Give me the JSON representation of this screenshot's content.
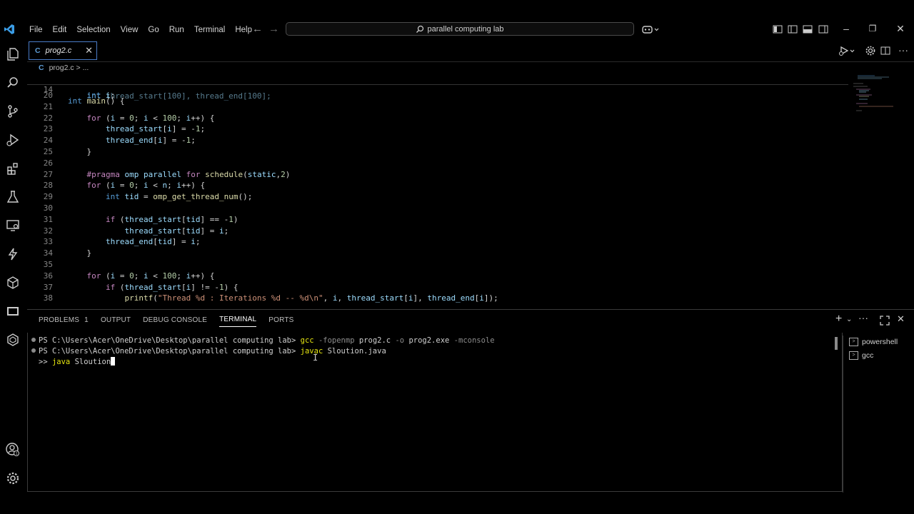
{
  "menu": [
    "File",
    "Edit",
    "Selection",
    "View",
    "Go",
    "Run",
    "Terminal",
    "Help"
  ],
  "search": {
    "text": "parallel computing lab"
  },
  "editor": {
    "tab_letter": "C",
    "tab_title": "prog2.c",
    "breadcrumb_file": "prog2.c",
    "breadcrumb_rest": "> ...",
    "sticky": {
      "num": "14",
      "text": "int main() {"
    },
    "lines": [
      {
        "num": "20",
        "text": "    int i;"
      },
      {
        "num": "21",
        "text": ""
      },
      {
        "num": "22",
        "text": "    for (i = 0; i < 100; i++) {"
      },
      {
        "num": "23",
        "text": "        thread_start[i] = -1;"
      },
      {
        "num": "24",
        "text": "        thread_end[i] = -1;"
      },
      {
        "num": "25",
        "text": "    }"
      },
      {
        "num": "26",
        "text": ""
      },
      {
        "num": "27",
        "text": "    #pragma omp parallel for schedule(static,2)"
      },
      {
        "num": "28",
        "text": "    for (i = 0; i < n; i++) {"
      },
      {
        "num": "29",
        "text": "        int tid = omp_get_thread_num();"
      },
      {
        "num": "30",
        "text": ""
      },
      {
        "num": "31",
        "text": "        if (thread_start[tid] == -1)"
      },
      {
        "num": "32",
        "text": "            thread_start[tid] = i;"
      },
      {
        "num": "33",
        "text": "        thread_end[tid] = i;"
      },
      {
        "num": "34",
        "text": "    }"
      },
      {
        "num": "35",
        "text": ""
      },
      {
        "num": "36",
        "text": "    for (i = 0; i < 100; i++) {"
      },
      {
        "num": "37",
        "text": "        if (thread_start[i] != -1) {"
      },
      {
        "num": "38",
        "text": "            printf(\"Thread %d : Iterations %d -- %d\\n\", i, thread_start[i], thread_end[i]);"
      }
    ]
  },
  "panel": {
    "tabs": [
      "PROBLEMS",
      "OUTPUT",
      "DEBUG CONSOLE",
      "TERMINAL",
      "PORTS"
    ],
    "problems_count": "1",
    "active_tab": "TERMINAL"
  },
  "terminal": {
    "prompt": "PS C:\\Users\\Acer\\OneDrive\\Desktop\\parallel computing lab> ",
    "line1": {
      "cmd": "gcc",
      "a1": "-fopenmp",
      "a2": "prog2.c",
      "a3": "-o",
      "a4": "prog2.exe",
      "a5": "-mconsole"
    },
    "line2": {
      "cmd": "javac",
      "arg": "Sloution.java"
    },
    "line3": {
      "prefix": ">> ",
      "cmd": "java",
      "arg": "Sloution"
    },
    "list": [
      "powershell",
      "gcc"
    ]
  },
  "colors": {
    "accent": "#4a7cc8",
    "background": "#000000",
    "keyword": "#569cd6",
    "function": "#dcdcaa",
    "string": "#ce9178",
    "number": "#b5cea8",
    "variable": "#9cdcfe",
    "control": "#c586c0"
  }
}
